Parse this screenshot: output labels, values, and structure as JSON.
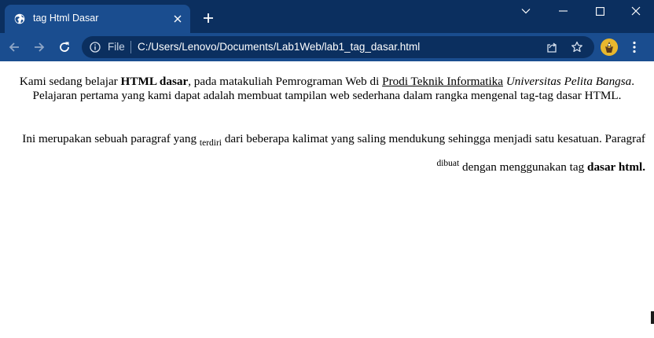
{
  "colors": {
    "tabstrip": "#0b2f5f",
    "toolbar": "#1a4d8f",
    "omnibox": "#0b2f5f",
    "page_background": "#ffffff"
  },
  "tab": {
    "title": "tag Html Dasar",
    "favicon": "globe-icon"
  },
  "address_bar": {
    "scheme_label": "File",
    "url": "C:/Users/Lenovo/Documents/Lab1Web/lab1_tag_dasar.html"
  },
  "page": {
    "paragraph1": {
      "text_before_bold": "Kami sedang belajar ",
      "bold": "HTML dasar",
      "text_before_link": ", pada matakuliah Pemrograman Web di ",
      "link": "Prodi Teknik Informatika",
      "text_before_italic": " ",
      "italic": "Universitas Pelita Bangsa",
      "text_after": ". Pelajaran pertama yang kami dapat adalah membuat tampilan web sederhana dalam rangka mengenal tag-tag dasar HTML."
    },
    "paragraph2": {
      "text_before_sub": "Ini merupakan sebuah paragraf yang ",
      "subscript": "terdiri",
      "text_after_sub": " dari beberapa kalimat yang saling mendukung sehingga menjadi satu kesatuan. Paragraf ",
      "superscript": "dibuat",
      "text_after_sup": " dengan menggunakan tag ",
      "bold": "dasar html."
    }
  }
}
